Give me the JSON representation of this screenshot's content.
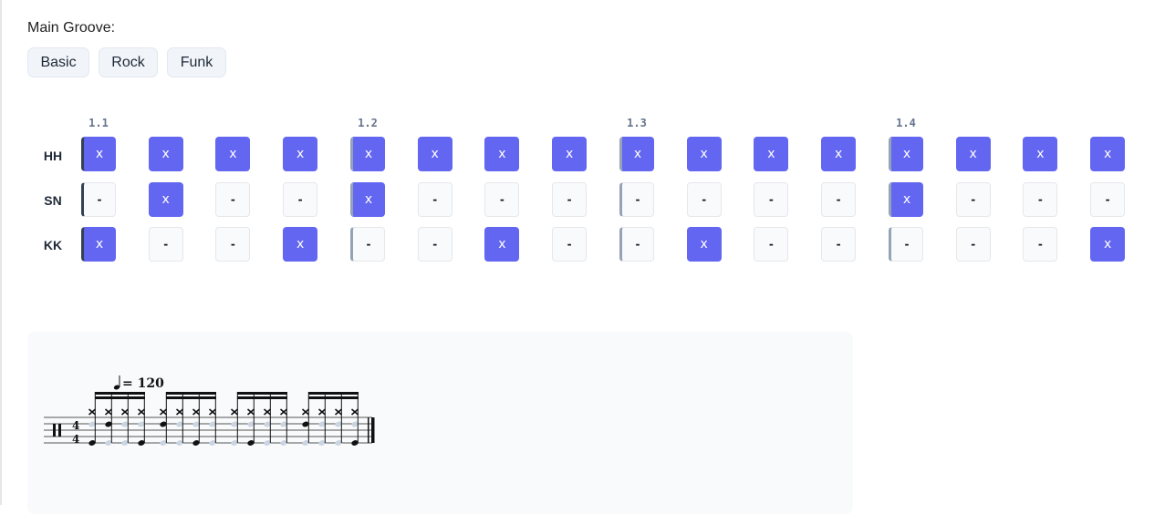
{
  "groove": {
    "label": "Main Groove:",
    "buttons": [
      "Basic",
      "Rock",
      "Funk"
    ]
  },
  "grid": {
    "beat_labels": [
      "1.1",
      "1.2",
      "1.3",
      "1.4"
    ],
    "on_symbol": "x",
    "off_symbol": "-",
    "rows": [
      {
        "label": "HH",
        "steps": [
          1,
          1,
          1,
          1,
          1,
          1,
          1,
          1,
          1,
          1,
          1,
          1,
          1,
          1,
          1,
          1
        ]
      },
      {
        "label": "SN",
        "steps": [
          0,
          1,
          0,
          0,
          1,
          0,
          0,
          0,
          0,
          0,
          0,
          0,
          1,
          0,
          0,
          0
        ]
      },
      {
        "label": "KK",
        "steps": [
          1,
          0,
          0,
          1,
          0,
          0,
          1,
          0,
          0,
          1,
          0,
          0,
          0,
          0,
          0,
          1
        ]
      }
    ],
    "colors": {
      "on": "#6366f1",
      "off": "#f8fafc"
    }
  },
  "notation": {
    "tempo": "= 120",
    "time_signature": [
      "4",
      "4"
    ]
  }
}
